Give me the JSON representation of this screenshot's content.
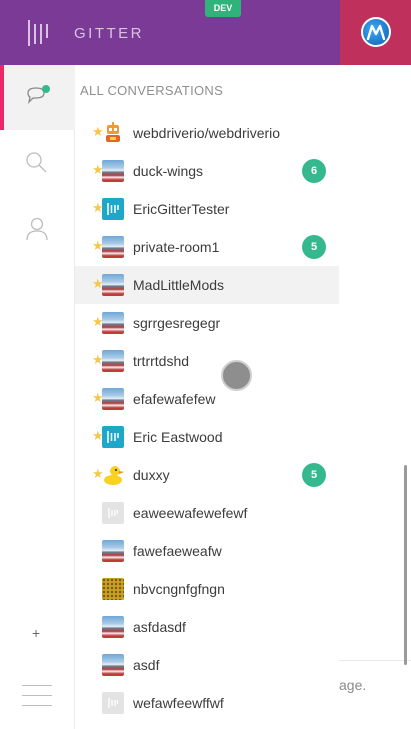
{
  "header": {
    "logo_text": "GITTER",
    "dev_badge": "DEV",
    "brand_color": "#7a3a96",
    "accent_color": "#c0305c"
  },
  "minibar": {
    "items": [
      {
        "name": "chat-icon",
        "active": true
      },
      {
        "name": "search-icon",
        "active": false
      },
      {
        "name": "person-icon",
        "active": false
      }
    ],
    "add_label": "+"
  },
  "conversations": {
    "title": "ALL CONVERSATIONS",
    "rooms": [
      {
        "name": "webdriverio/webdriverio",
        "avatar": "robot",
        "starred": true,
        "unread": ""
      },
      {
        "name": "duck-wings",
        "avatar": "landscape",
        "starred": true,
        "unread": "6"
      },
      {
        "name": "EricGitterTester",
        "avatar": "teal",
        "starred": true,
        "unread": ""
      },
      {
        "name": "private-room1",
        "avatar": "landscape",
        "starred": true,
        "unread": "5"
      },
      {
        "name": "MadLittleMods",
        "avatar": "landscape",
        "starred": true,
        "unread": ""
      },
      {
        "name": "sgrrgesregegr",
        "avatar": "landscape",
        "starred": true,
        "unread": ""
      },
      {
        "name": "trtrrtdshd",
        "avatar": "landscape",
        "starred": true,
        "unread": ""
      },
      {
        "name": "efafewafefew",
        "avatar": "landscape",
        "starred": true,
        "unread": ""
      },
      {
        "name": "Eric Eastwood",
        "avatar": "teal",
        "starred": true,
        "unread": ""
      },
      {
        "name": "duxxy",
        "avatar": "duck",
        "starred": true,
        "unread": "5"
      },
      {
        "name": "eaweewafewefewf",
        "avatar": "gray",
        "starred": false,
        "unread": ""
      },
      {
        "name": "fawefaeweafw",
        "avatar": "landscape",
        "starred": false,
        "unread": ""
      },
      {
        "name": "nbvcngnfgfngn",
        "avatar": "pattern",
        "starred": false,
        "unread": ""
      },
      {
        "name": "asfdasdf",
        "avatar": "landscape",
        "starred": false,
        "unread": ""
      },
      {
        "name": "asdf",
        "avatar": "landscape",
        "starred": false,
        "unread": ""
      },
      {
        "name": "wefawfeewffwf",
        "avatar": "gray",
        "starred": false,
        "unread": ""
      }
    ]
  },
  "chat_input": {
    "placeholder_fragment": "age."
  },
  "colors": {
    "unread_badge": "#35b88d",
    "star": "#f2c94c",
    "active_marker": "#e9296a"
  }
}
